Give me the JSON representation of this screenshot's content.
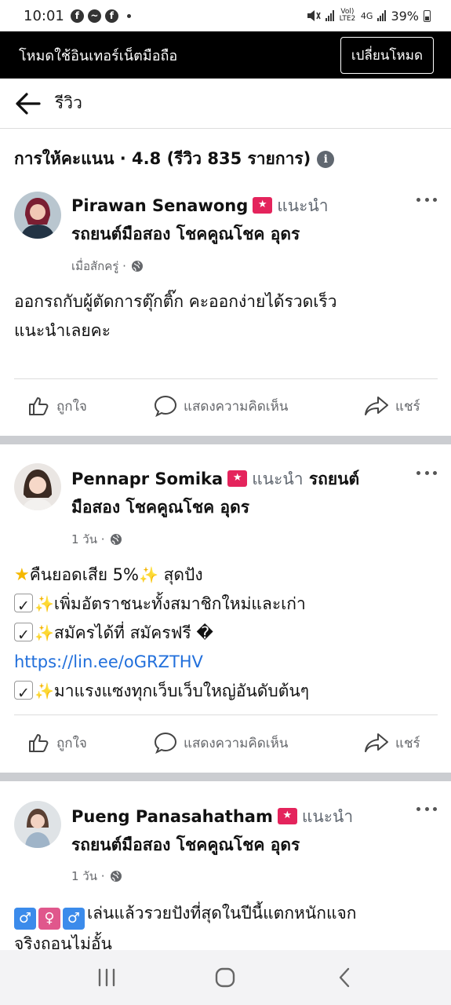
{
  "status_bar": {
    "time": "10:01",
    "signal_label": "Vol) LTE2",
    "network": "4G",
    "battery": "39%"
  },
  "banner": {
    "text": "โหมดใช้อินเทอร์เน็ตมือถือ",
    "button": "เปลี่ยนโหมด"
  },
  "header": {
    "title": "รีวิว"
  },
  "rating": {
    "text": "การให้คะแนน · 4.8 (รีวิว 835 รายการ)"
  },
  "reviews": [
    {
      "name": "Pirawan Senawong",
      "recommend": "แนะนำ",
      "page": "รถยนต์มือสอง โชคคูณโชค อุดร",
      "time": "เมื่อสักครู่ ·",
      "lines": [
        "ออกรถกับผู้ตัดการตุ๊กติ๊ก คะออกง่ายได้รวดเร็ว",
        "แนะนำเลยคะ"
      ]
    },
    {
      "name": "Pennapr Somika",
      "recommend": "แนะนำ",
      "page_part1": "รถยนต์",
      "page_part2": "มือสอง โชคคูณโชค อุดร",
      "time": "1 วัน ·",
      "lines": [
        "คืนยอดเสีย 5%",
        "สุดปัง",
        "เพิ่มอัตราชนะทั้งสมาชิกใหม่และเก่า",
        "สมัครได้ที่ สมัครฟรี �",
        "https://lin.ee/oGRZTHV",
        "มาแรงแซงทุกเว็บเว็บใหญ่อันดับต้นๆ"
      ]
    },
    {
      "name": "Pueng Panasahatham",
      "recommend": "แนะนำ",
      "page": "รถยนต์มือสอง โชคคูณโชค อุดร",
      "time": "1 วัน ·",
      "lines": [
        "เล่นแล้วรวยปังที่สุดในปีนี้แตกหนักแจก",
        "จริงถอนไม่อั้น"
      ]
    }
  ],
  "actions": {
    "like": "ถูกใจ",
    "comment": "แสดงความคิดเห็น",
    "share": "แชร์"
  },
  "colors": {
    "badge": "#e4245c",
    "link": "#216fdb",
    "separator": "#cbcdd1"
  }
}
